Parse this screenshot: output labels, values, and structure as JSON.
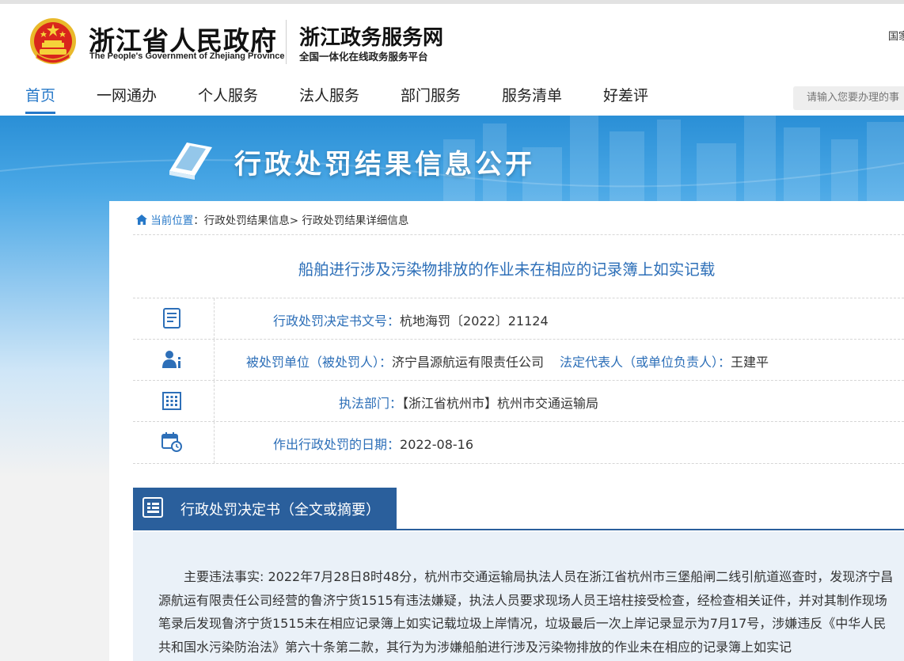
{
  "header": {
    "brand_cn": "浙江省人民政府",
    "brand_en": "The People's Government of Zhejiang Province",
    "service_cn": "浙江政务服务网",
    "service_sub": "全国一体化在线政务服务平台",
    "top_right": "国家"
  },
  "nav": {
    "items": [
      {
        "label": "首页",
        "active": true
      },
      {
        "label": "一网通办"
      },
      {
        "label": "个人服务"
      },
      {
        "label": "法人服务"
      },
      {
        "label": "部门服务"
      },
      {
        "label": "服务清单"
      },
      {
        "label": "好差评"
      }
    ],
    "search_placeholder": "请输入您要办理的事"
  },
  "banner": {
    "title": "行政处罚结果信息公开"
  },
  "breadcrumb": {
    "home_label": "当前位置",
    "colon": "：",
    "level1": "行政处罚结果信息",
    "sep": "> ",
    "level2": "行政处罚结果详细信息"
  },
  "record": {
    "title": "船舶进行涉及污染物排放的作业未在相应的记录簿上如实记载",
    "doc_no_label": "行政处罚决定书文号：",
    "doc_no": "杭地海罚〔2022〕21124",
    "party_label": "被处罚单位（被处罚人）：",
    "party": "济宁昌源航运有限责任公司",
    "rep_label": "法定代表人（或单位负责人）：",
    "rep": "王建平",
    "dept_label": "执法部门：",
    "dept": "【浙江省杭州市】杭州市交通运输局",
    "date_label": "作出行政处罚的日期：",
    "date": "2022-08-16"
  },
  "section": {
    "title": "行政处罚决定书（全文或摘要）",
    "body": "主要违法事实: 2022年7月28日8时48分，杭州市交通运输局执法人员在浙江省杭州市三堡船闸二线引航道巡查时，发现济宁昌源航运有限责任公司经营的鲁济宁货1515有违法嫌疑，执法人员要求现场人员王培柱接受检查，经检查相关证件，并对其制作现场笔录后发现鲁济宁货1515未在相应记录簿上如实记载垃圾上岸情况，垃圾最后一次上岸记录显示为7月17号，涉嫌违反《中华人民共和国水污染防治法》第六十条第二款，其行为为涉嫌船舶进行涉及污染物排放的作业未在相应的记录簿上如实记"
  },
  "colors": {
    "accent": "#2678c8",
    "title_blue": "#2d6fb8",
    "section_blue": "#2a5f9c"
  }
}
